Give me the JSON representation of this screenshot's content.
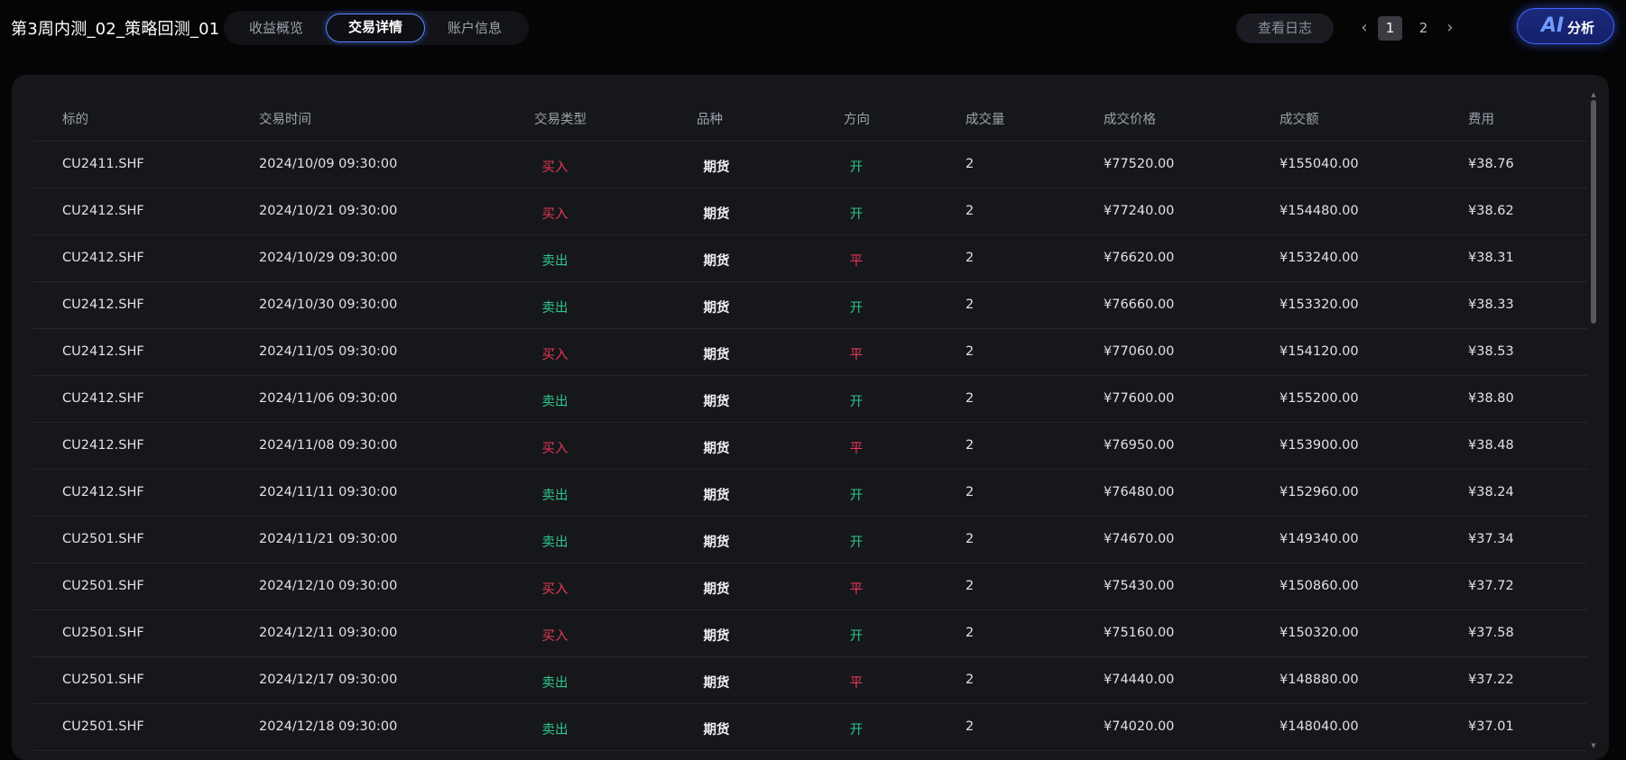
{
  "header": {
    "title": "第3周内测_02_策略回测_01",
    "tabs": [
      {
        "label": "收益概览",
        "active": false
      },
      {
        "label": "交易详情",
        "active": true
      },
      {
        "label": "账户信息",
        "active": false
      }
    ],
    "log_button": "查看日志",
    "pagination": {
      "prev_icon": "‹",
      "next_icon": "›",
      "pages": [
        "1",
        "2"
      ],
      "current": "1"
    },
    "ai_button": {
      "icon_text": "AI",
      "label": "分析"
    }
  },
  "colors": {
    "buy": "#e8385a",
    "sell": "#2ec48a",
    "accent": "#3f66ff"
  },
  "table": {
    "columns": [
      "标的",
      "交易时间",
      "交易类型",
      "品种",
      "方向",
      "成交量",
      "成交价格",
      "成交额",
      "费用"
    ],
    "rows": [
      {
        "symbol": "CU2411.SHF",
        "time": "2024/10/09 09:30:00",
        "type": "买入",
        "kind": "期货",
        "direction": "开",
        "volume": "2",
        "price": "¥77520.00",
        "amount": "¥155040.00",
        "fee": "¥38.76"
      },
      {
        "symbol": "CU2412.SHF",
        "time": "2024/10/21 09:30:00",
        "type": "买入",
        "kind": "期货",
        "direction": "开",
        "volume": "2",
        "price": "¥77240.00",
        "amount": "¥154480.00",
        "fee": "¥38.62"
      },
      {
        "symbol": "CU2412.SHF",
        "time": "2024/10/29 09:30:00",
        "type": "卖出",
        "kind": "期货",
        "direction": "平",
        "volume": "2",
        "price": "¥76620.00",
        "amount": "¥153240.00",
        "fee": "¥38.31"
      },
      {
        "symbol": "CU2412.SHF",
        "time": "2024/10/30 09:30:00",
        "type": "卖出",
        "kind": "期货",
        "direction": "开",
        "volume": "2",
        "price": "¥76660.00",
        "amount": "¥153320.00",
        "fee": "¥38.33"
      },
      {
        "symbol": "CU2412.SHF",
        "time": "2024/11/05 09:30:00",
        "type": "买入",
        "kind": "期货",
        "direction": "平",
        "volume": "2",
        "price": "¥77060.00",
        "amount": "¥154120.00",
        "fee": "¥38.53"
      },
      {
        "symbol": "CU2412.SHF",
        "time": "2024/11/06 09:30:00",
        "type": "卖出",
        "kind": "期货",
        "direction": "开",
        "volume": "2",
        "price": "¥77600.00",
        "amount": "¥155200.00",
        "fee": "¥38.80"
      },
      {
        "symbol": "CU2412.SHF",
        "time": "2024/11/08 09:30:00",
        "type": "买入",
        "kind": "期货",
        "direction": "平",
        "volume": "2",
        "price": "¥76950.00",
        "amount": "¥153900.00",
        "fee": "¥38.48"
      },
      {
        "symbol": "CU2412.SHF",
        "time": "2024/11/11 09:30:00",
        "type": "卖出",
        "kind": "期货",
        "direction": "开",
        "volume": "2",
        "price": "¥76480.00",
        "amount": "¥152960.00",
        "fee": "¥38.24"
      },
      {
        "symbol": "CU2501.SHF",
        "time": "2024/11/21 09:30:00",
        "type": "卖出",
        "kind": "期货",
        "direction": "开",
        "volume": "2",
        "price": "¥74670.00",
        "amount": "¥149340.00",
        "fee": "¥37.34"
      },
      {
        "symbol": "CU2501.SHF",
        "time": "2024/12/10 09:30:00",
        "type": "买入",
        "kind": "期货",
        "direction": "平",
        "volume": "2",
        "price": "¥75430.00",
        "amount": "¥150860.00",
        "fee": "¥37.72"
      },
      {
        "symbol": "CU2501.SHF",
        "time": "2024/12/11 09:30:00",
        "type": "买入",
        "kind": "期货",
        "direction": "开",
        "volume": "2",
        "price": "¥75160.00",
        "amount": "¥150320.00",
        "fee": "¥37.58"
      },
      {
        "symbol": "CU2501.SHF",
        "time": "2024/12/17 09:30:00",
        "type": "卖出",
        "kind": "期货",
        "direction": "平",
        "volume": "2",
        "price": "¥74440.00",
        "amount": "¥148880.00",
        "fee": "¥37.22"
      },
      {
        "symbol": "CU2501.SHF",
        "time": "2024/12/18 09:30:00",
        "type": "卖出",
        "kind": "期货",
        "direction": "开",
        "volume": "2",
        "price": "¥74020.00",
        "amount": "¥148040.00",
        "fee": "¥37.01"
      }
    ]
  }
}
